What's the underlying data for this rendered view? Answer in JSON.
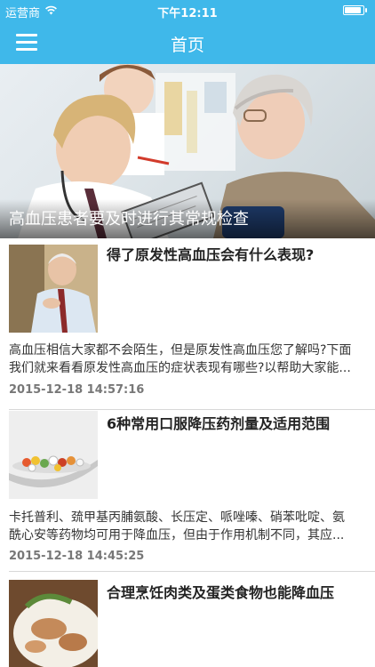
{
  "status_bar": {
    "carrier": "运营商",
    "time": "下午12:11",
    "icons": [
      "wifi-icon",
      "battery-icon"
    ]
  },
  "nav": {
    "title": "首页",
    "menu_icon": "hamburger-menu-icon"
  },
  "hero": {
    "title": "高血压患者要及时进行其常规检查"
  },
  "articles": [
    {
      "title": "得了原发性高血压会有什么表现?",
      "summary_line1": "高血压相信大家都不会陌生，但是原发性高血压您了解吗?下面",
      "summary_line2": "我们就来看看原发性高血压的症状表现有哪些?以帮助大家能...",
      "date": "2015-12-18 14:57:16"
    },
    {
      "title": "6种常用口服降压药剂量及适用范围",
      "summary_line1": "卡托普利、巯甲基丙脯氨酸、长压定、哌唑嗪、硝苯吡啶、氨",
      "summary_line2": "酰心安等药物均可用于降血压，但由于作用机制不同，其应...",
      "date": "2015-12-18 14:45:25"
    },
    {
      "title": "合理烹饪肉类及蛋类食物也能降血压"
    }
  ],
  "colors": {
    "accent": "#3fb8ea",
    "date_text": "#777777",
    "divider": "#d8d8d8"
  }
}
